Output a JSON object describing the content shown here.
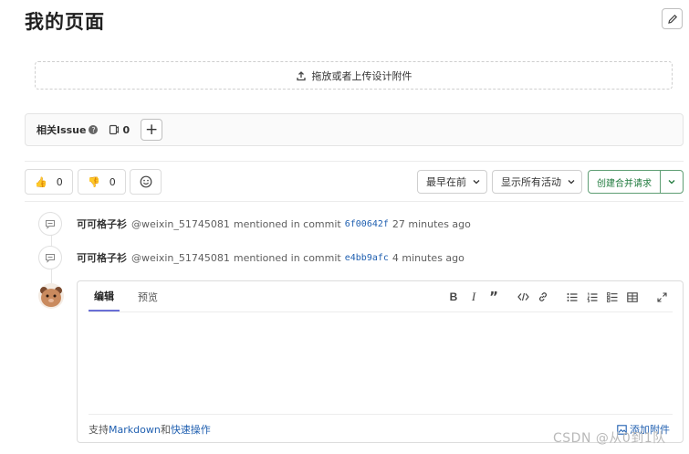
{
  "page": {
    "title": "我的页面"
  },
  "upload": {
    "label": "拖放或者上传设计附件"
  },
  "related": {
    "label": "相关Issue",
    "count": "0"
  },
  "awards": {
    "thumbs_up_count": "0",
    "thumbs_down_count": "0"
  },
  "filters": {
    "sort_label": "最早在前",
    "activity_label": "显示所有活动",
    "merge_label": "创建合并请求"
  },
  "notes": [
    {
      "author": "可可格子衫",
      "handle": "@weixin_51745081",
      "action": "mentioned in commit",
      "commit": "6f00642f",
      "time": "27 minutes ago"
    },
    {
      "author": "可可格子衫",
      "handle": "@weixin_51745081",
      "action": "mentioned in commit",
      "commit": "e4bb9afc",
      "time": "4 minutes ago"
    }
  ],
  "editor": {
    "tab_write": "编辑",
    "tab_preview": "预览",
    "footer_prefix": "支持",
    "footer_markdown": "Markdown",
    "footer_and": "和",
    "footer_quick": "快速操作",
    "attach_label": "添加附件"
  },
  "watermark": {
    "text": "CSDN @从0到1队"
  },
  "colors": {
    "accent": "#6a6fd6",
    "merge_green": "#1f7a3d",
    "link": "#1f5fb0"
  }
}
